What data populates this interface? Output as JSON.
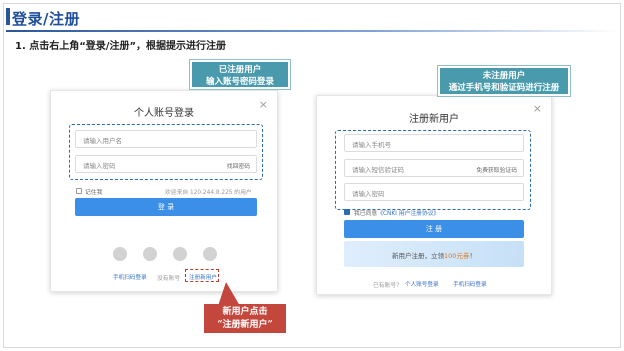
{
  "slide": {
    "title": "登录/注册",
    "step": "1. 点击右上角“登录/注册”，根据提示进行注册"
  },
  "login": {
    "title": "个人账号登录",
    "close": "×",
    "username_placeholder": "请输入用户名",
    "password_placeholder": "请输入密码",
    "forgot": "找回密码",
    "remember": "记住我",
    "welcome": "欢迎来自 120.244.8.225 的用户",
    "login_button": "登 录",
    "social_icons": [
      "qq-icon",
      "wechat-icon",
      "weibo-icon",
      "other-login-icon"
    ],
    "phone_login": "手机扫码登录",
    "no_account": "没有账号",
    "register_link": "注册新用户"
  },
  "register": {
    "title": "注册新用户",
    "close": "×",
    "phone_placeholder": "请输入手机号",
    "sms_placeholder": "请输入短信验证码",
    "get_code": "免费获取验证码",
    "password_placeholder": "请输入密码",
    "agree_prefix": "我已同意",
    "agree_link": "《CNKI 用户注册协议》",
    "register_button": "注 册",
    "banner_prefix": "新用户注册，立领",
    "banner_accent": "100元券",
    "banner_suffix": "！",
    "have_account": "已有账号？",
    "personal_login": "个人账号登录",
    "phone_login": "手机扫码登录"
  },
  "callouts": {
    "registered_line1": "已注册用户",
    "registered_line2": "输入账号密码登录",
    "unregistered_line1": "未注册用户",
    "unregistered_line2": "通过手机号和验证码进行注册",
    "new_user_line1": "新用户点击",
    "new_user_line2": "“注册新用户”"
  }
}
